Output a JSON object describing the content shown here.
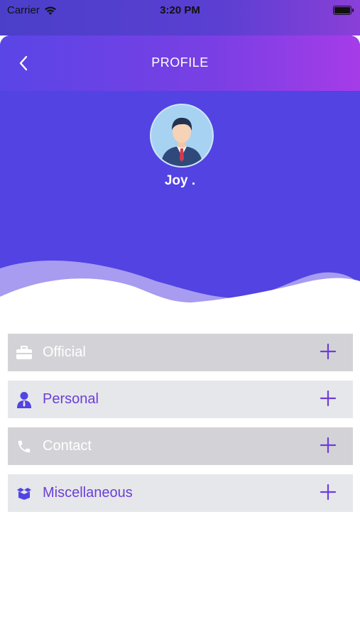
{
  "status_bar": {
    "carrier": "Carrier",
    "time": "3:20 PM"
  },
  "header": {
    "title": "PROFILE",
    "user_name": "Joy ."
  },
  "sections": [
    {
      "label": "Official",
      "icon": "briefcase-icon"
    },
    {
      "label": "Personal",
      "icon": "person-icon"
    },
    {
      "label": "Contact",
      "icon": "phone-icon"
    },
    {
      "label": "Miscellaneous",
      "icon": "box-icon"
    }
  ],
  "colors": {
    "header_bg": "#5243e2",
    "accent": "#6c3ed6",
    "row_dark": "#d3d3d7",
    "row_light": "#e6e7eb"
  }
}
